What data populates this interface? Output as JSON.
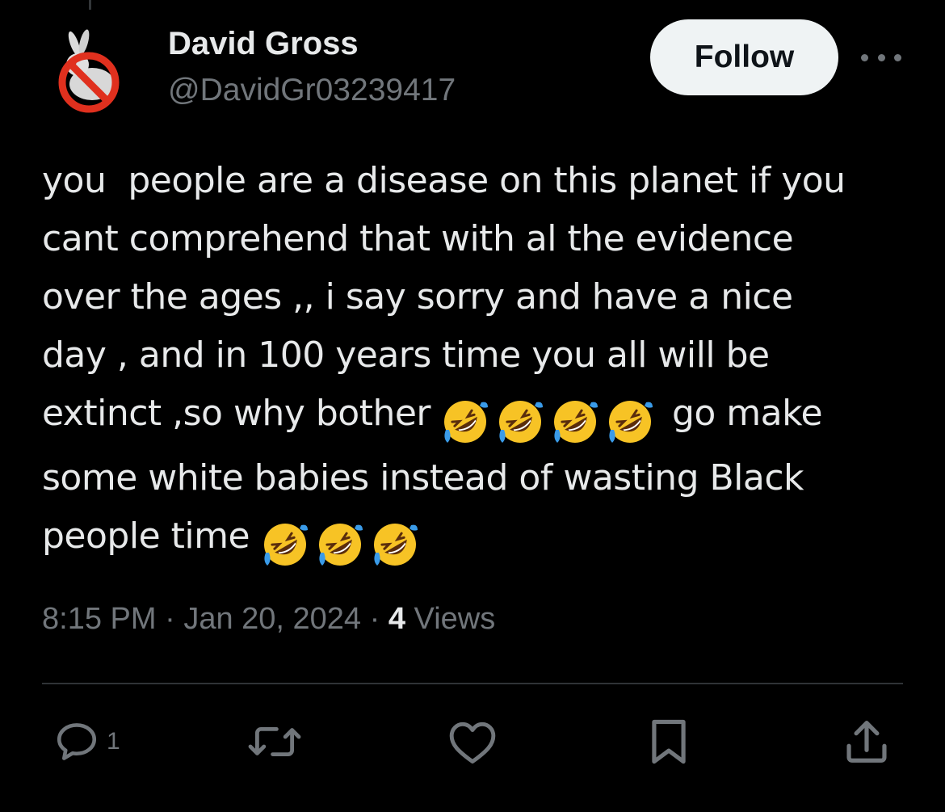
{
  "author": {
    "display_name": "David Gross",
    "handle": "@DavidGr03239417"
  },
  "header": {
    "follow_label": "Follow"
  },
  "tweet": {
    "lines": [
      "you  people are a disease on this planet if you",
      "cant comprehend that with al the evidence",
      "over the ages ,, i say sorry and have a nice",
      "day , and in 100 years time you all will be"
    ],
    "line5_before": "extinct ,so why bother ",
    "line5_after": " go make",
    "line6": "some white babies instead of wasting Black",
    "line7": "people time "
  },
  "meta": {
    "time": "8:15 PM",
    "separator": "·",
    "date": "Jan 20, 2024",
    "views_count": "4",
    "views_label": "Views"
  },
  "actions": {
    "reply_count": "1"
  },
  "icons": {
    "avatar": "no-rabbit-avatar",
    "more": "more-dots-icon",
    "reply": "reply-icon",
    "retweet": "retweet-icon",
    "like": "heart-icon",
    "bookmark": "bookmark-icon",
    "share": "share-icon",
    "emoji": "rolling-on-floor-laughing-emoji"
  },
  "colors": {
    "background": "#000000",
    "text_primary": "#e7e9ea",
    "text_secondary": "#71767b",
    "follow_bg": "#eff3f4",
    "divider": "#2f3336"
  }
}
